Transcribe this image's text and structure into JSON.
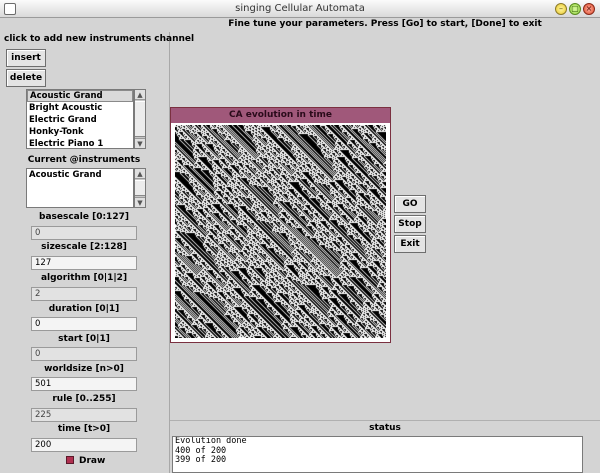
{
  "window": {
    "title": "singing Cellular Automata",
    "buttons": {
      "minimize": "–",
      "maximize": "▢",
      "close": "×"
    }
  },
  "instruction": "Fine tune your parameters. Press [Go] to start, [Done] to exit",
  "left_panel": {
    "heading": "click to add new instruments channel",
    "insert_label": "insert",
    "delete_label": "delete",
    "instruments": [
      "Acoustic Grand",
      "Bright Acoustic",
      "Electric Grand",
      "Honky-Tonk",
      "Electric Piano 1"
    ],
    "selected_instrument_index": 0,
    "current_label": "Current @instruments",
    "current_items": [
      "Acoustic Grand"
    ],
    "params": [
      {
        "label": "basescale [0:127]",
        "value": "0"
      },
      {
        "label": "sizescale [2:128]",
        "value": "127"
      },
      {
        "label": "algorithm [0|1|2]",
        "value": "2"
      },
      {
        "label": "duration [0|1]",
        "value": "0"
      },
      {
        "label": "start [0|1]",
        "value": "0"
      },
      {
        "label": "worldsize [n>0]",
        "value": "501"
      },
      {
        "label": "rule [0..255]",
        "value": "225"
      },
      {
        "label": "time [t>0]",
        "value": "200"
      }
    ],
    "draw_label": "Draw",
    "draw_checked": true
  },
  "ca_window": {
    "title": "CA evolution in time",
    "rule": 225
  },
  "controls": {
    "go_label": "GO",
    "stop_label": "Stop",
    "exit_label": "Exit"
  },
  "status": {
    "heading": "status",
    "lines": [
      "Evolution done",
      "400 of 200",
      "399 of 200"
    ]
  },
  "colors": {
    "ca_title_bg": "#a0587a",
    "draw_checkbox": "#b03050"
  }
}
